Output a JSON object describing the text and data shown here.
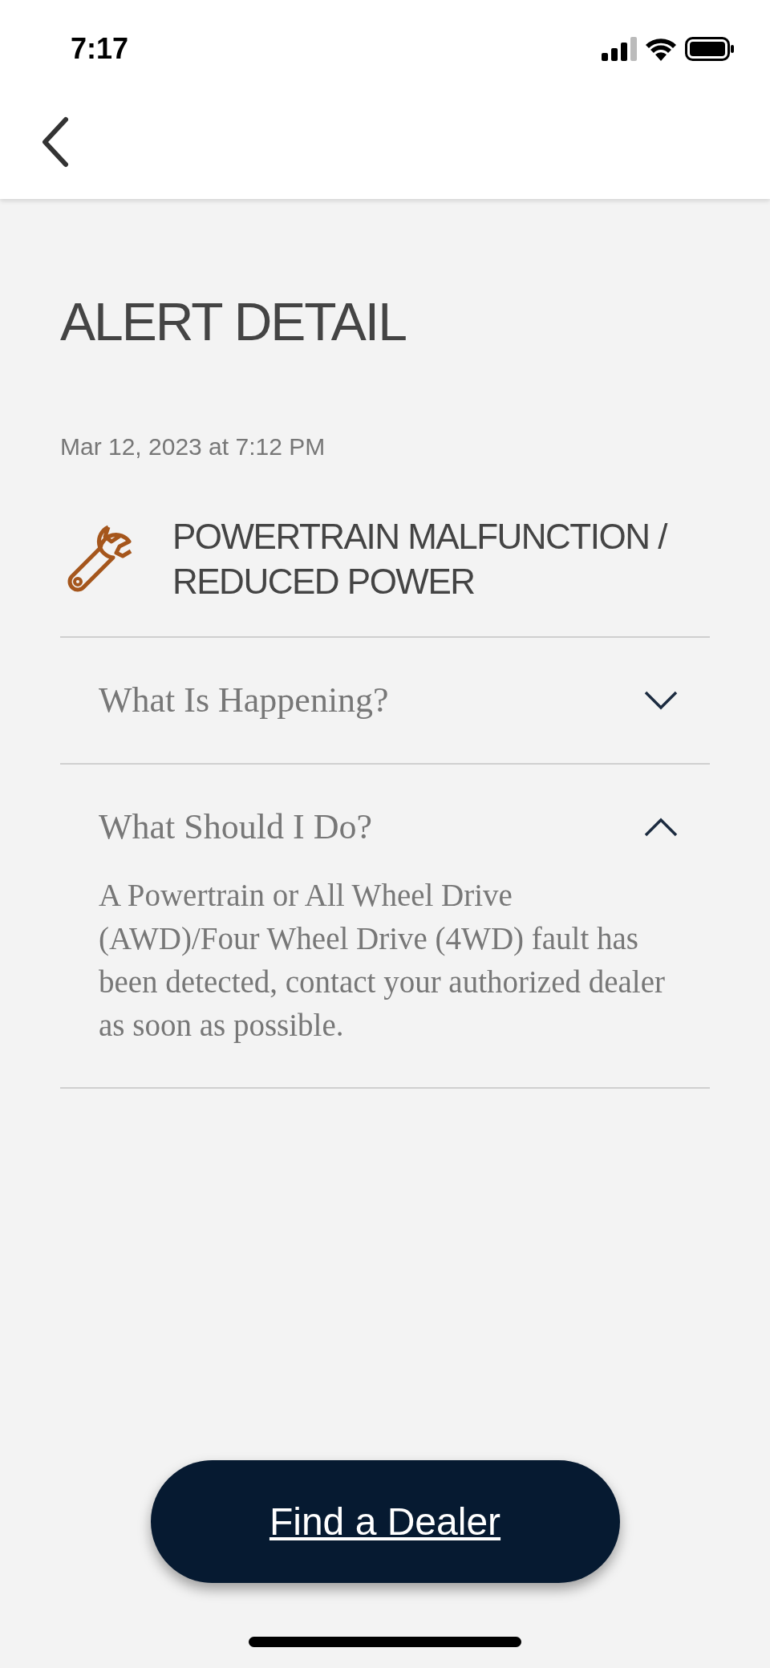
{
  "status_bar": {
    "time": "7:17"
  },
  "title": "ALERT DETAIL",
  "date": "Mar 12, 2023 at 7:12 PM",
  "alert": {
    "title": "POWERTRAIN MALFUNCTION / REDUCED POWER"
  },
  "sections": [
    {
      "title": "What Is Happening?",
      "expanded": false
    },
    {
      "title": "What Should I Do?",
      "expanded": true,
      "body": "A Powertrain or All Wheel Drive (AWD)/Four Wheel Drive (4WD) fault has been detected, contact your authorized dealer as soon as possible."
    }
  ],
  "button": "Find a Dealer"
}
